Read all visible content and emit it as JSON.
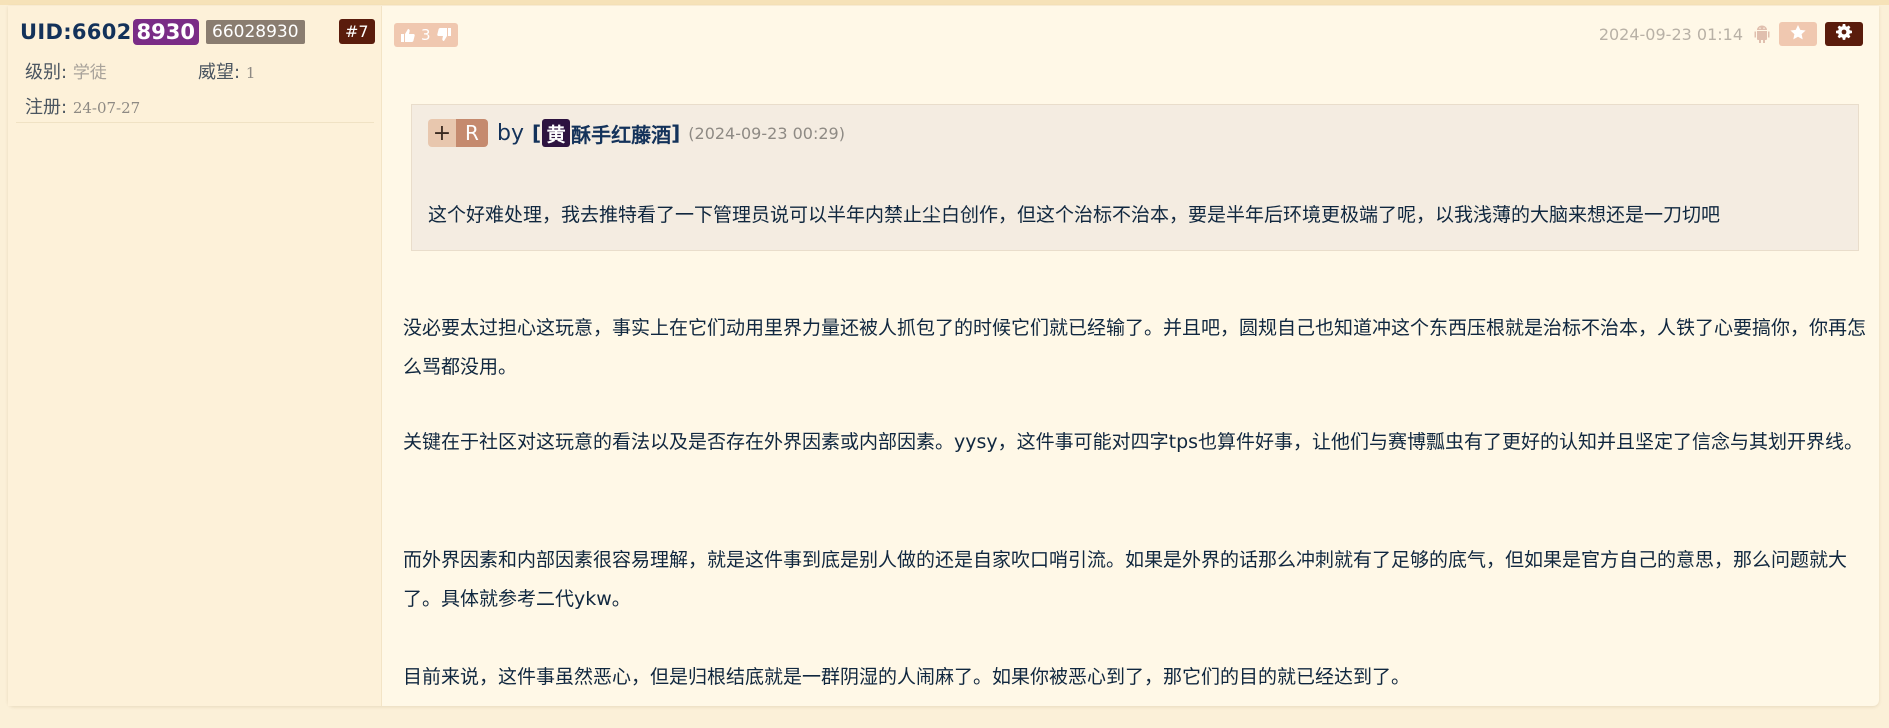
{
  "user": {
    "uid_label": "UID:6602",
    "uid_highlight": "8930",
    "uid_full": "66028930",
    "level_label": "级别:",
    "level_value": "学徒",
    "prestige_label": "威望:",
    "prestige_value": "1",
    "register_label": "注册:",
    "register_value": "24-07-27"
  },
  "floor": "#7",
  "vote": {
    "count": "3"
  },
  "meta": {
    "date": "2024-09-23 01:14"
  },
  "quote": {
    "plus": "+",
    "r": "R",
    "by": "by",
    "bracket_open": "[",
    "avatar_char": "黄",
    "username": "酥手红藤酒",
    "bracket_close": "]",
    "time": "(2024-09-23 00:29)",
    "text": "这个好难处理，我去推特看了一下管理员说可以半年内禁止尘白创作，但这个治标不治本，要是半年后环境更极端了呢，以我浅薄的大脑来想还是一刀切吧"
  },
  "paragraphs": [
    "没必要太过担心这玩意，事实上在它们动用里界力量还被人抓包了的时候它们就已经输了。并且吧，圆规自己也知道冲这个东西压根就是治标不治本，人铁了心要搞你，你再怎么骂都没用。",
    "关键在于社区对这玩意的看法以及是否存在外界因素或内部因素。yysy，这件事可能对四字tps也算件好事，让他们与赛博瓢虫有了更好的认知并且坚定了信念与其划开界线。",
    "而外界因素和内部因素很容易理解，就是这件事到底是别人做的还是自家吹口哨引流。如果是外界的话那么冲刺就有了足够的底气，但如果是官方自己的意思，那么问题就大了。具体就参考二代ykw。",
    "目前来说，这件事虽然恶心，但是归根结底就是一群阴湿的人闹麻了。如果你被恶心到了，那它们的目的就已经达到了。"
  ],
  "colors": {
    "accent_dark": "#5a1c0c",
    "accent_light": "#f0c8b0",
    "uid_highlight": "#7a2c86",
    "text": "#10273f"
  },
  "icons": [
    "thumbs-up-icon",
    "thumbs-down-icon",
    "android-icon",
    "star-icon",
    "gear-icon"
  ]
}
